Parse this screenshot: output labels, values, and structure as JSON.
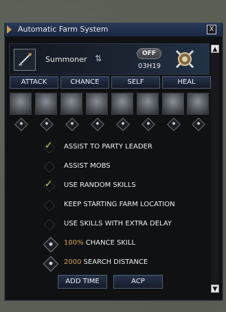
{
  "window": {
    "title": "Automatic Farm System",
    "close_label": "X"
  },
  "header": {
    "class_label": "Summoner",
    "toggle_label": "OFF",
    "timer": "03H19"
  },
  "tabs": [
    {
      "label": "ATTACK"
    },
    {
      "label": "CHANCE"
    },
    {
      "label": "SELF"
    },
    {
      "label": "HEAL"
    }
  ],
  "options": [
    {
      "label": "ASSIST TO PARTY LEADER",
      "checked": true
    },
    {
      "label": "ASSIST MOBS",
      "checked": false
    },
    {
      "label": "USE RANDOM SKILLS",
      "checked": true
    },
    {
      "label": "KEEP STARTING FARM LOCATION",
      "checked": false
    },
    {
      "label": "USE SKILLS WITH EXTRA DELAY",
      "checked": false
    }
  ],
  "settings": {
    "chance_value": "100%",
    "chance_label": "CHANCE SKILL",
    "distance_value": "2000",
    "distance_label": "SEARCH DISTANCE"
  },
  "buttons": {
    "add_time": "ADD TIME",
    "acp": "ACP"
  },
  "colors": {
    "accent": "#d9a24b",
    "check": "#b7d65a",
    "tab_border": "#50607a"
  }
}
